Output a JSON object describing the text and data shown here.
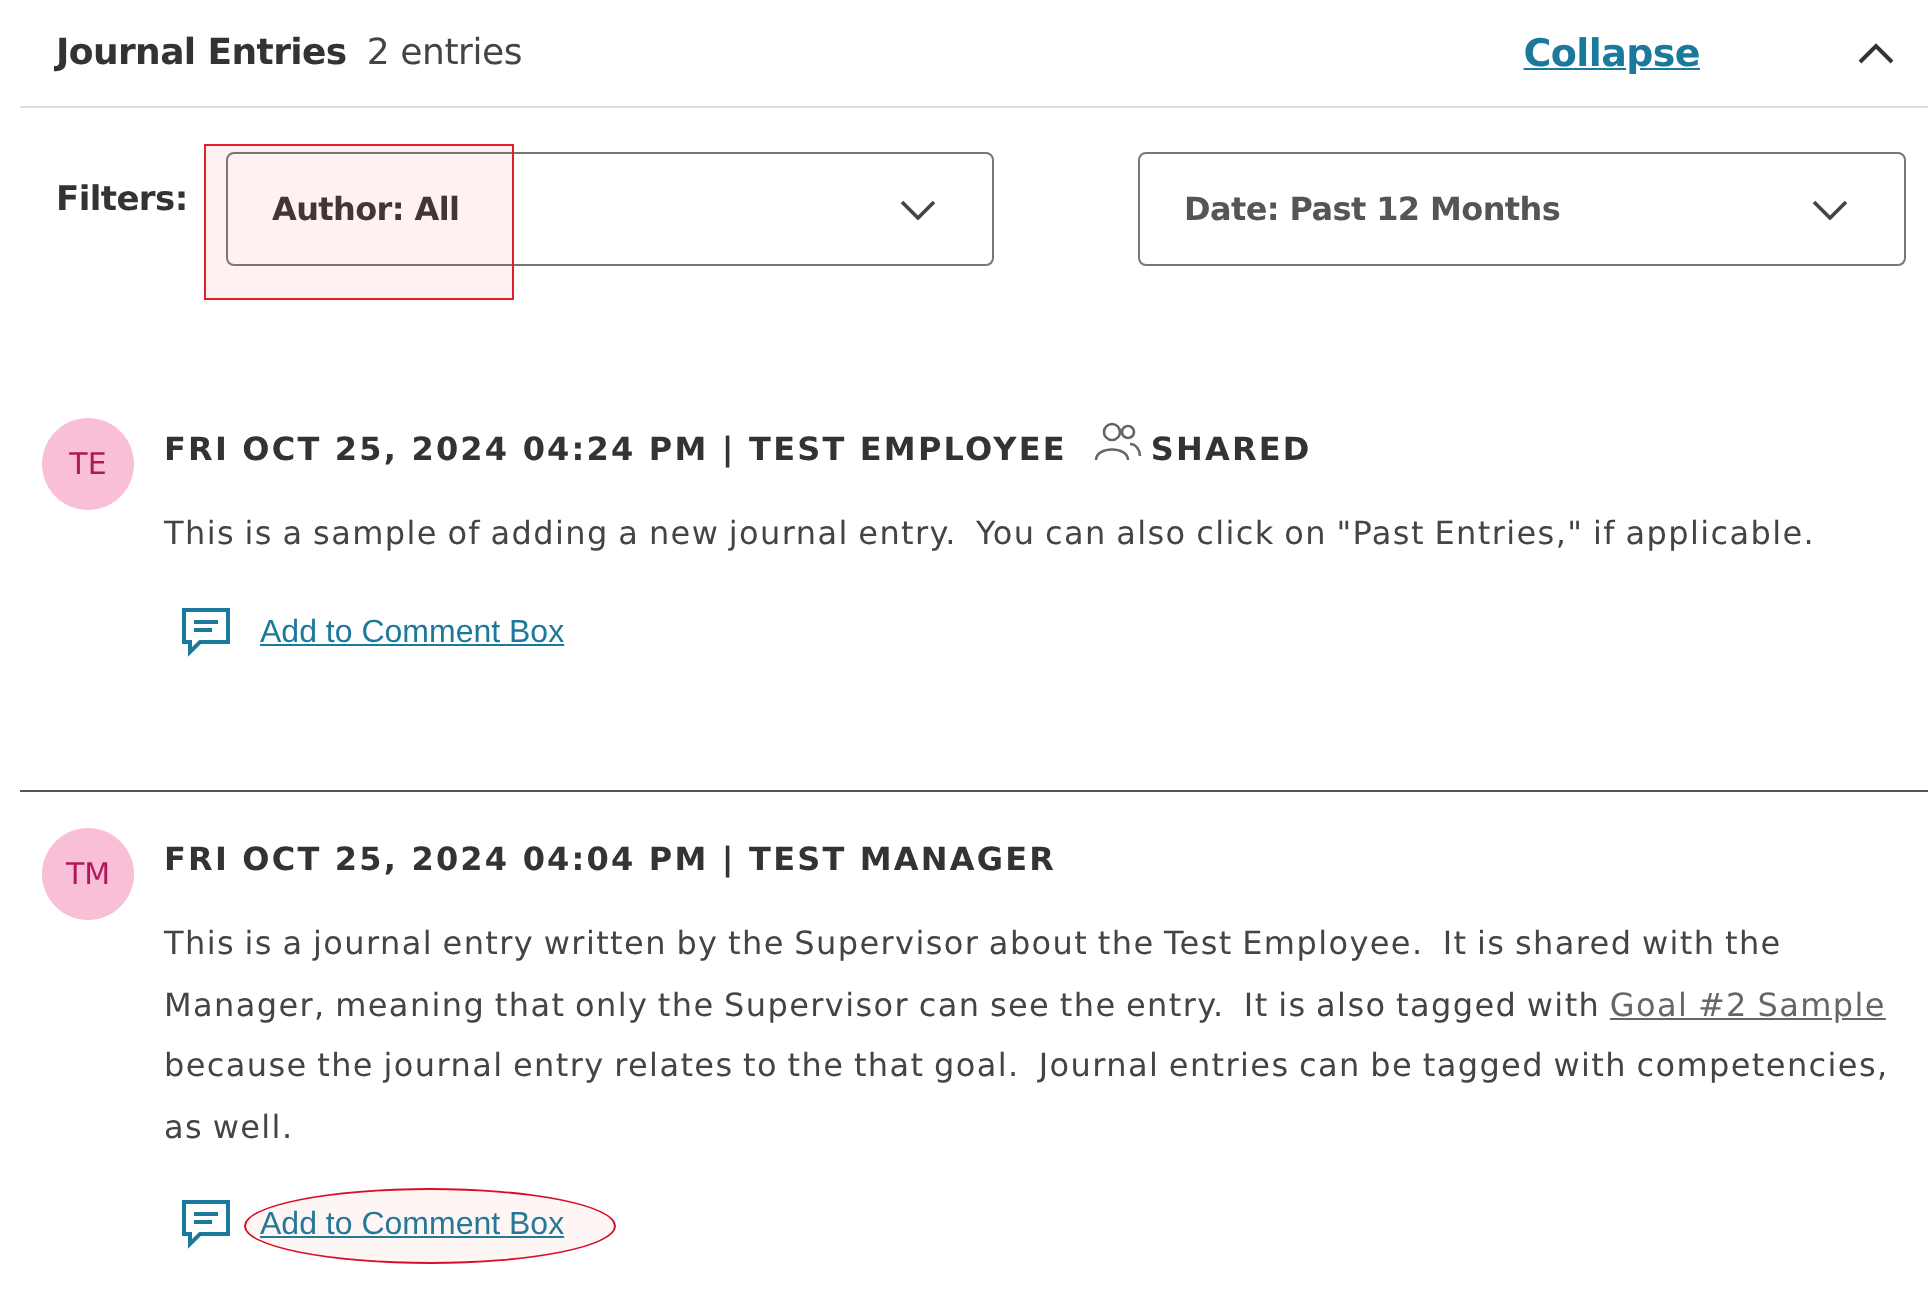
{
  "section": {
    "title": "Journal Entries",
    "count": "2 entries",
    "collapse_link": "Collapse",
    "expanded": true
  },
  "filters": {
    "label": "Filters:",
    "dropdowns": [
      {
        "value": "Author: All",
        "highlighted": true
      },
      {
        "value": "Date: Past 12 Months",
        "highlighted": false
      }
    ]
  },
  "entries": [
    {
      "initials": "TE",
      "header": "FRI OCT 25, 2024 04:24 PM | TEST EMPLOYEE",
      "shared": true,
      "shared_label": "SHARED",
      "body": [
        {
          "kind": "text",
          "text": "This is a sample of adding a new journal entry.  You can also click on \"Past Entries,\" if applicable."
        }
      ],
      "comment_link": "Add to Comment Box",
      "highlighted": false
    },
    {
      "initials": "TM",
      "header": "FRI OCT 25, 2024 04:04 PM | TEST MANAGER",
      "shared": false,
      "body": [
        {
          "kind": "text",
          "text": "This is a journal entry written by the Supervisor about the Test Employee.  It is shared with the Manager, meaning that only the Supervisor can see the entry.  It is also tagged with "
        },
        {
          "kind": "link",
          "text": "Goal #2 Sample"
        },
        {
          "kind": "text",
          "text": " because the journal entry relates to the that goal.  Journal entries can be tagged with competencies, as well."
        }
      ],
      "comment_link": "Add to Comment Box",
      "highlighted": true
    }
  ]
}
